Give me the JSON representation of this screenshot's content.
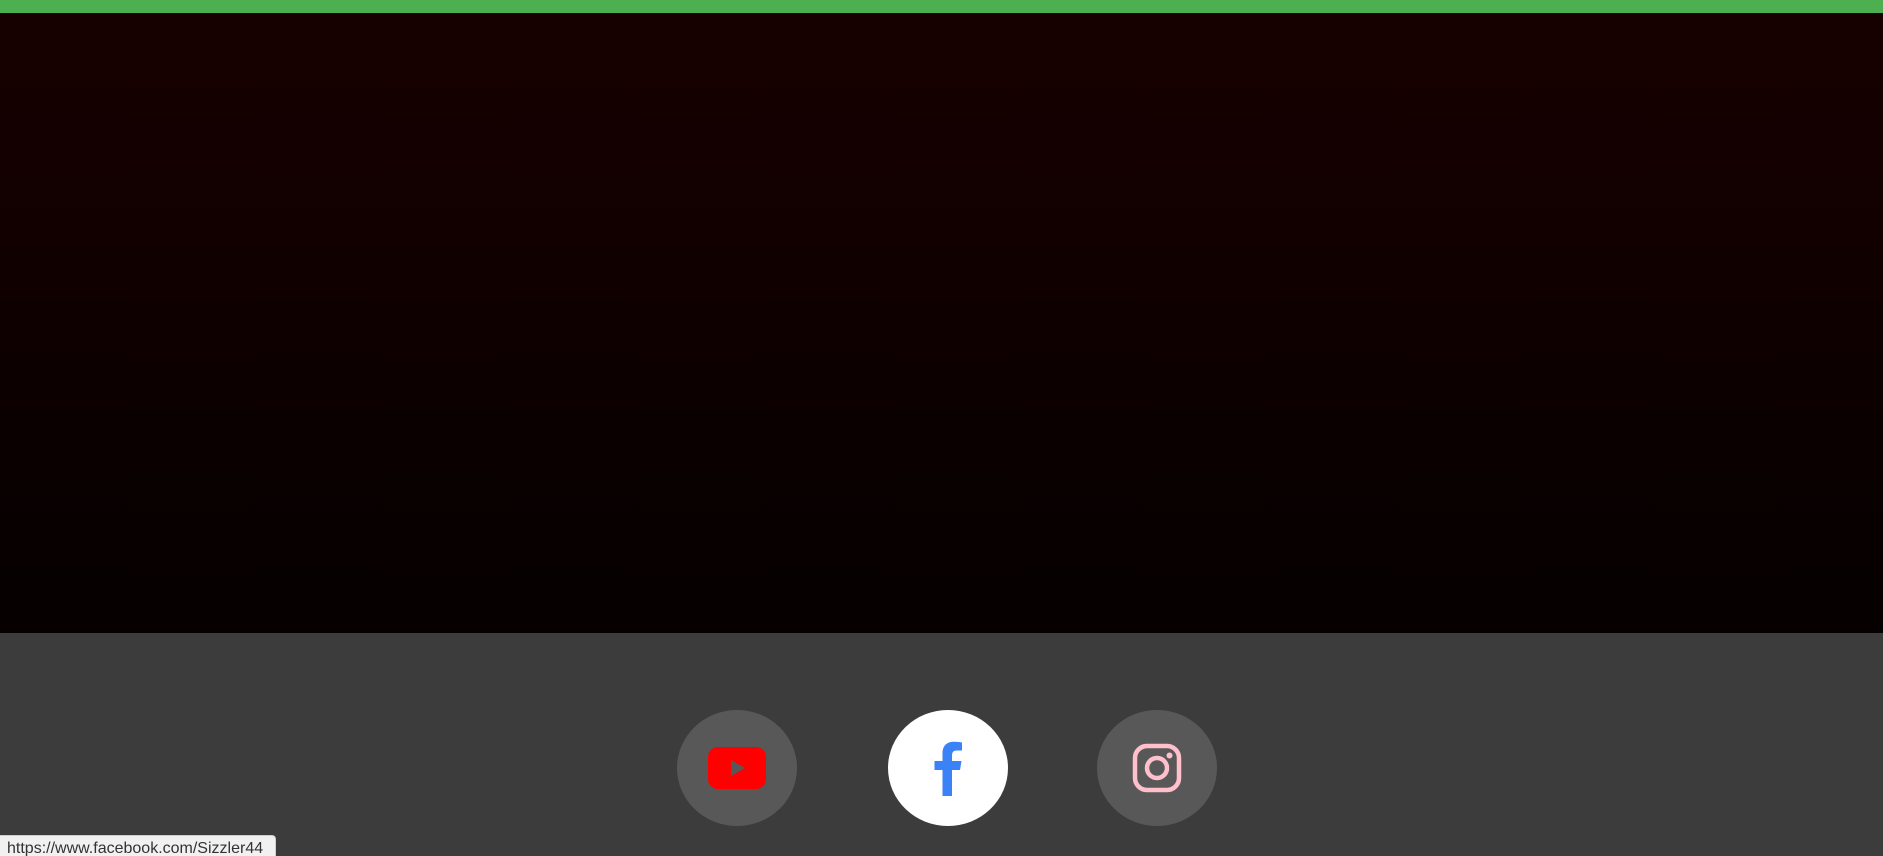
{
  "colors": {
    "accent": "#4caf50",
    "hero_top": "#170000",
    "hero_bottom": "#060000",
    "footer_bg": "#3c3c3c",
    "social_button_bg": "#585858",
    "social_button_active_bg": "#ffffff",
    "youtube": "#ff0000",
    "facebook": "#3b82f6",
    "instagram": "#ffc0cb"
  },
  "social": {
    "items": [
      {
        "name": "youtube",
        "icon": "youtube-icon"
      },
      {
        "name": "facebook",
        "icon": "facebook-icon",
        "hovered": true
      },
      {
        "name": "instagram",
        "icon": "instagram-icon"
      }
    ]
  },
  "status_bar": {
    "url": "https://www.facebook.com/Sizzler44"
  }
}
